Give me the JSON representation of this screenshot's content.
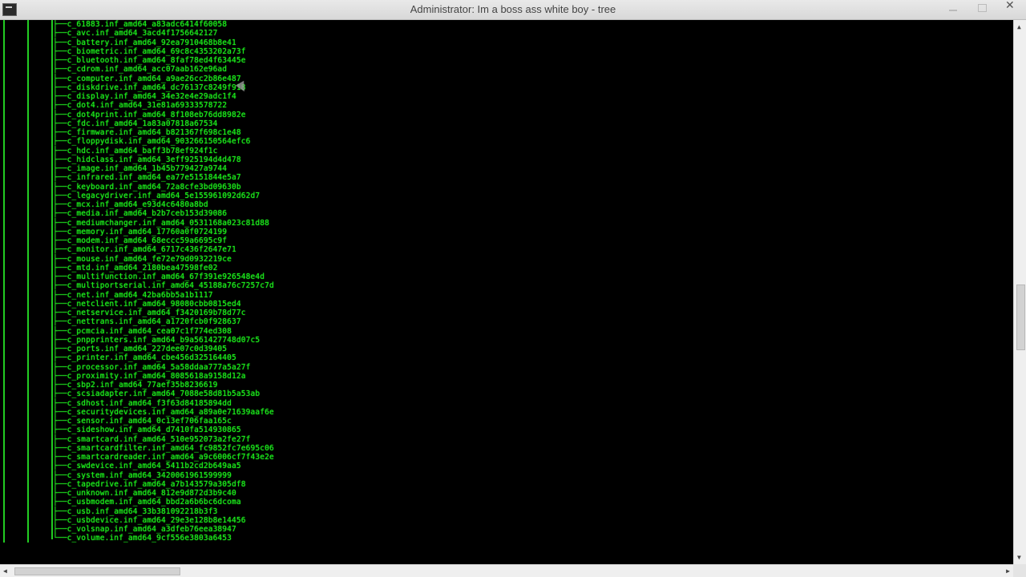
{
  "window": {
    "title": "Administrator:  Im a boss ass white boy - tree"
  },
  "tree": {
    "branch": "├──",
    "last_branch": "└──",
    "entries": [
      "c_61883.inf_amd64_a83adc6414f60058",
      "c_avc.inf_amd64_3acd4f1756642127",
      "c_battery.inf_amd64_92ea7910468b8e41",
      "c_biometric.inf_amd64_69c8c4353202a73f",
      "c_bluetooth.inf_amd64_8faf78ed4f63445e",
      "c_cdrom.inf_amd64_acc07aab162e96ad",
      "c_computer.inf_amd64_a9ae26cc2b86e487",
      "c_diskdrive.inf_amd64_dc76137c8249f918",
      "c_display.inf_amd64_34e32e4e29adc1f4",
      "c_dot4.inf_amd64_31e81a69333578722",
      "c_dot4print.inf_amd64_8f108eb76dd8982e",
      "c_fdc.inf_amd64_1a83a07818a67534",
      "c_firmware.inf_amd64_b821367f698c1e48",
      "c_floppydisk.inf_amd64_903266150564efc6",
      "c_hdc.inf_amd64_baff3b78ef924f1c",
      "c_hidclass.inf_amd64_3eff925194d4d478",
      "c_image.inf_amd64_1b45b779427a9744",
      "c_infrared.inf_amd64_ea77e5151844e5a7",
      "c_keyboard.inf_amd64_72a8cfe3bd09630b",
      "c_legacydriver.inf_amd64_5e155961092d62d7",
      "c_mcx.inf_amd64_e93d4c6480a8bd",
      "c_media.inf_amd64_b2b7ceb153d39086",
      "c_mediumchanger.inf_amd64_0531168a023c81d88",
      "c_memory.inf_amd64_17760a0f0724199",
      "c_modem.inf_amd64_68eccc59a6695c9f",
      "c_monitor.inf_amd64_6717c436f2647e71",
      "c_mouse.inf_amd64_fe72e79d0932219ce",
      "c_mtd.inf_amd64_2180bea47598fe02",
      "c_multifunction.inf_amd64_67f391e926548e4d",
      "c_multiportserial.inf_amd64_45188a76c7257c7d",
      "c_net.inf_amd64_42ba6bb5a1b1117",
      "c_netclient.inf_amd64_98080cbb0815ed4",
      "c_netservice.inf_amd64_f3420169b78d77c",
      "c_nettrans.inf_amd64_a1720fcb0f928637",
      "c_pcmcia.inf_amd64_cea07c1f774ed308",
      "c_pnpprinters.inf_amd64_b9a561427748d07c5",
      "c_ports.inf_amd64_227dee07c0d39405",
      "c_printer.inf_amd64_cbe456d325164405",
      "c_processor.inf_amd64_5a58ddaa777a5a27f",
      "c_proximity.inf_amd64_8085618a9158d12a",
      "c_sbp2.inf_amd64_77aef35b8236619",
      "c_scsiadapter.inf_amd64_7088e58d81b5a53ab",
      "c_sdhost.inf_amd64_f3f63d84185894dd",
      "c_securitydevices.inf_amd64_a89a0e71639aaf6e",
      "c_sensor.inf_amd64_0c13ef706faa165c",
      "c_sideshow.inf_amd64_d7410fa514930865",
      "c_smartcard.inf_amd64_510e952073a2fe27f",
      "c_smartcardfilter.inf_amd64_fc9852fc7e695c06",
      "c_smartcardreader.inf_amd64_a9c6006cf7f43e2e",
      "c_swdevice.inf_amd64_5411b2cd2b649aa5",
      "c_system.inf_amd64_3420061961599999",
      "c_tapedrive.inf_amd64_a7b143579a305df8",
      "c_unknown.inf_amd64_812e9d872d3b9c40",
      "c_usbmodem.inf_amd64_bbd2a6b6bc6dcoma",
      "c_usb.inf_amd64_33b381092218b3f3",
      "c_usbdevice.inf_amd64_29e3e128b8e14456",
      "c_volsnap.inf_amd64_a3dfeb76eea38947",
      "c_volume.inf_amd64_9cf556e3803a6453"
    ]
  },
  "icons": {
    "arrow_up": "▲",
    "arrow_down": "▼",
    "arrow_left": "◀",
    "arrow_right": "▶",
    "close": "✕"
  }
}
